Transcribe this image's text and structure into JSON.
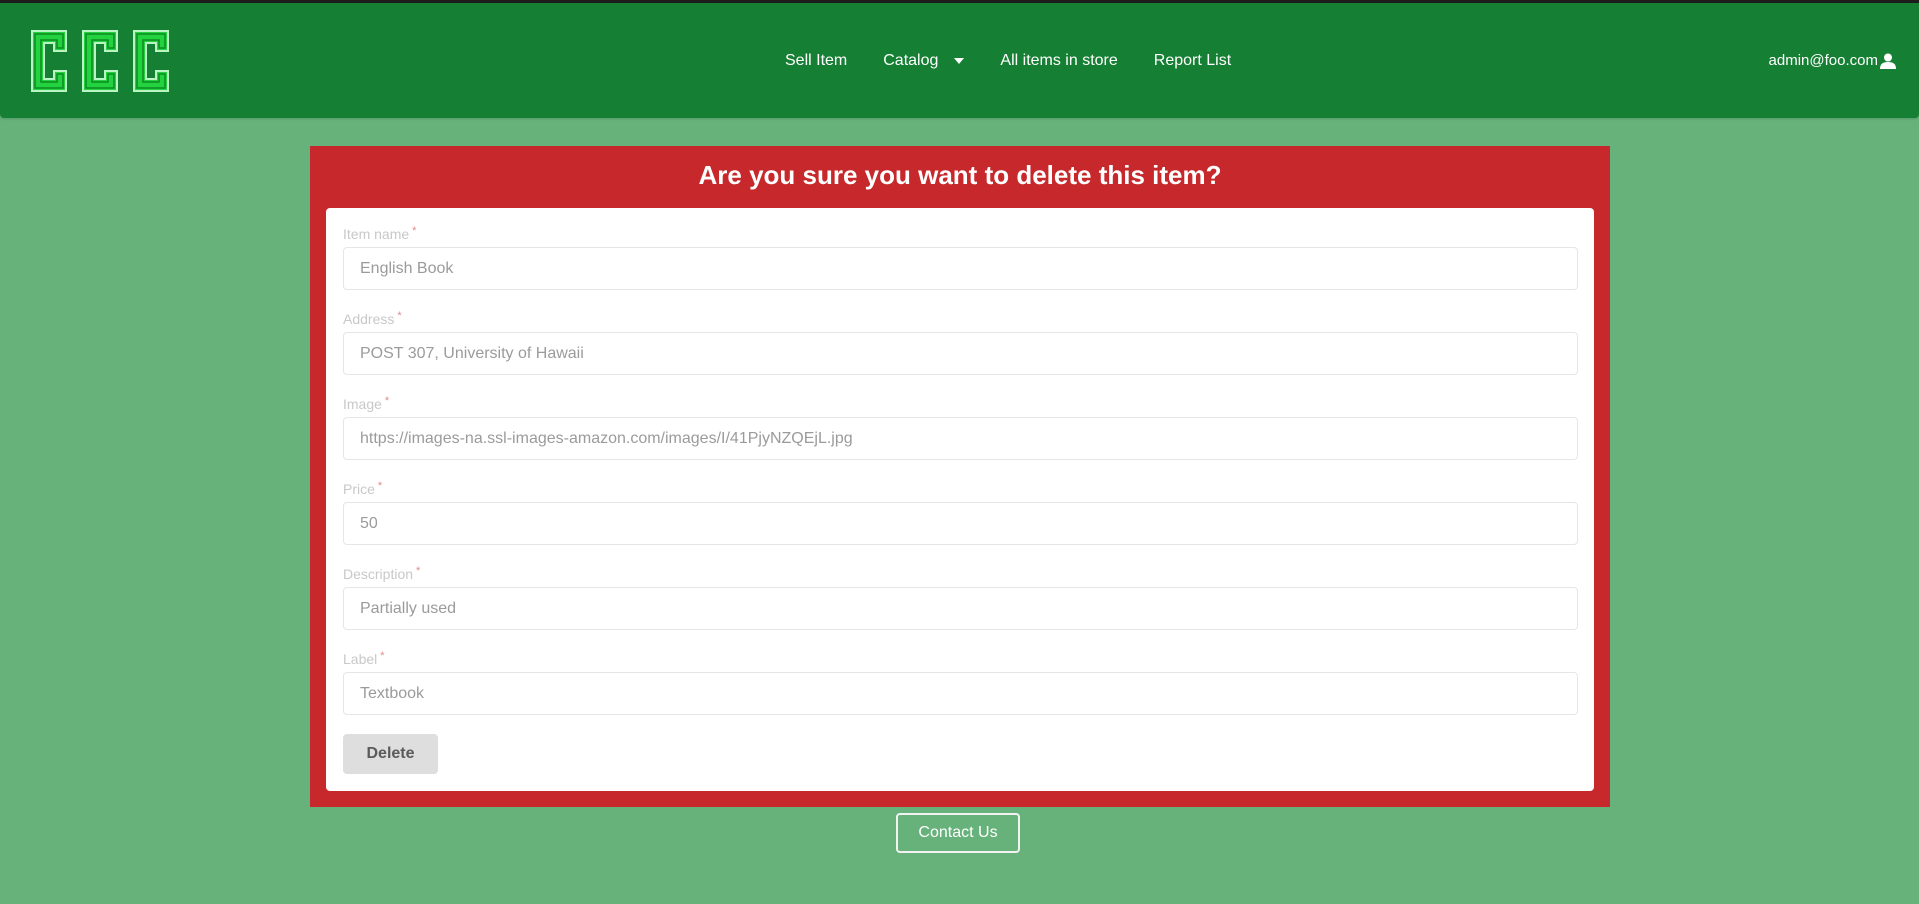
{
  "navbar": {
    "logo_text": "CCC",
    "links": {
      "sell_item": "Sell Item",
      "catalog": "Catalog",
      "all_items": "All items in store",
      "report_list": "Report List"
    },
    "user_email": "admin@foo.com"
  },
  "dialog": {
    "title": "Are you sure you want to delete this item?",
    "fields": [
      {
        "label": "Item name",
        "value": "English Book"
      },
      {
        "label": "Address",
        "value": "POST 307, University of Hawaii"
      },
      {
        "label": "Image",
        "value": "https://images-na.ssl-images-amazon.com/images/I/41PjyNZQEjL.jpg"
      },
      {
        "label": "Price",
        "value": "50"
      },
      {
        "label": "Description",
        "value": "Partially used"
      },
      {
        "label": "Label",
        "value": "Textbook"
      }
    ],
    "required_marker": "*",
    "delete_label": "Delete"
  },
  "footer": {
    "contact_label": "Contact Us"
  },
  "colors": {
    "page_bg": "#66b27a",
    "navbar_bg": "#157f33",
    "dialog_bg": "#c6282b",
    "logo_green": "#22d33f"
  },
  "icons": {
    "user": "user-icon",
    "catalog_caret": "caret-down-icon"
  }
}
